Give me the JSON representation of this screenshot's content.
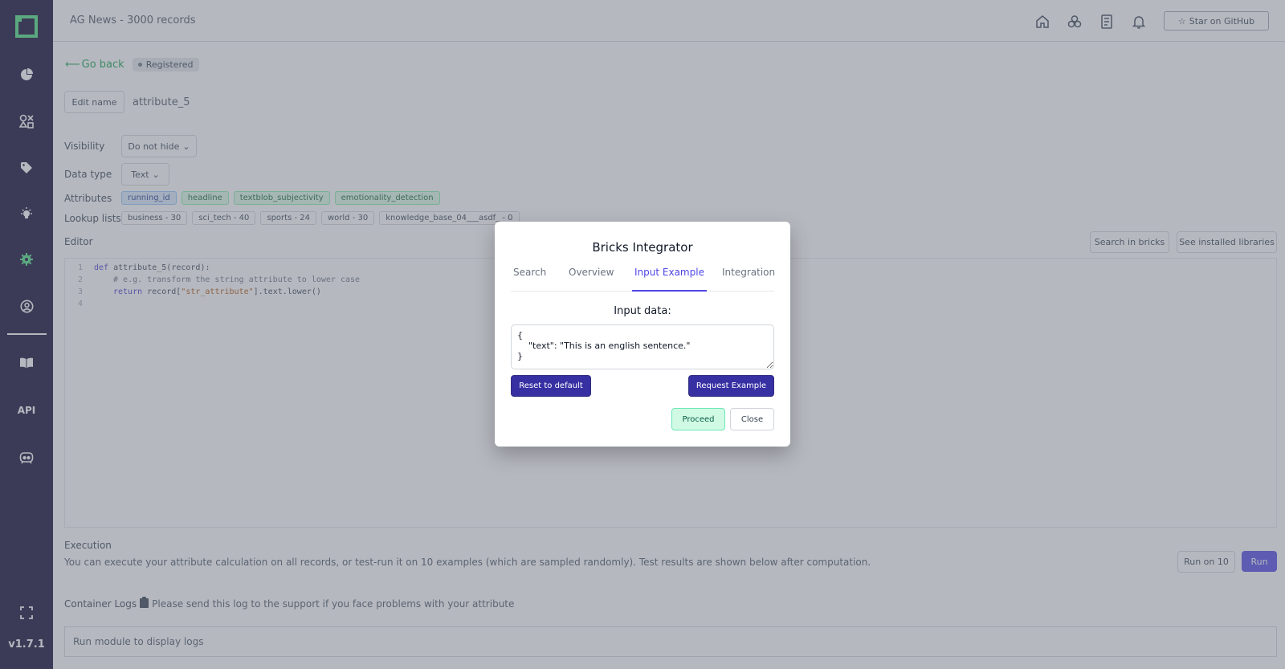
{
  "sidebar": {
    "version": "v1.7.1",
    "api_label": "API",
    "icons": [
      "pie-chart-icon",
      "shapes-icon",
      "tag-icon",
      "bulb-icon",
      "settings-icon",
      "user-circle-icon",
      "book-icon",
      "api-icon",
      "discord-icon",
      "fullscreen-icon"
    ]
  },
  "topbar": {
    "project_title": "AG News - 3000 records",
    "github_label": "Star on GitHub",
    "icons": [
      "home-icon",
      "circles-icon",
      "document-icon",
      "bell-icon"
    ]
  },
  "main": {
    "back_label": "Go back",
    "status": "Registered",
    "edit_name_label": "Edit name",
    "attribute_name": "attribute_5",
    "visibility_label": "Visibility",
    "visibility_value": "Do not hide",
    "data_type_label": "Data type",
    "data_type_value": "Text",
    "attributes_label": "Attributes",
    "attributes": [
      "running_id",
      "headline",
      "textblob_subjectivity",
      "emotionality_detection"
    ],
    "lookup_label": "Lookup lists",
    "lookup_lists": [
      "business - 30",
      "sci_tech - 40",
      "sports - 24",
      "world - 30",
      "knowledge_base_04___asdf_ - 0"
    ],
    "editor_label": "Editor",
    "search_bricks_label": "Search in bricks",
    "installed_libs_label": "See installed libraries",
    "code": {
      "line1_kw": "def",
      "line1_rest": " attribute_5(record):",
      "line2": "# e.g. transform the string attribute to lower case",
      "line3_kw": "return",
      "line3_a": " record[",
      "line3_str": "\"str_attribute\"",
      "line3_b": "].text.lower()",
      "line_numbers": [
        "1",
        "2",
        "3",
        "4"
      ]
    },
    "execution_label": "Execution",
    "execution_text": "You can execute your attribute calculation on all records, or test-run it on 10 examples (which are sampled randomly). Test results are shown below after computation.",
    "run10_label": "Run on 10",
    "run_label": "Run",
    "logs_label": "Container Logs",
    "logs_hint": "Please send this log to the support if you face problems with your attribute",
    "logs_placeholder": "Run module to display logs"
  },
  "modal": {
    "title": "Bricks Integrator",
    "tabs": [
      "Search",
      "Overview",
      "Input Example",
      "Integration"
    ],
    "active_tab": "Input Example",
    "input_label": "Input data:",
    "input_value": "{\n    \"text\": \"This is an english sentence.\"\n}",
    "reset_label": "Reset to default",
    "request_label": "Request Example",
    "proceed_label": "Proceed",
    "close_label": "Close"
  },
  "colors": {
    "sidebar_bg": "#0c052e",
    "accent": "#4f46e5",
    "success": "#16a34a"
  }
}
